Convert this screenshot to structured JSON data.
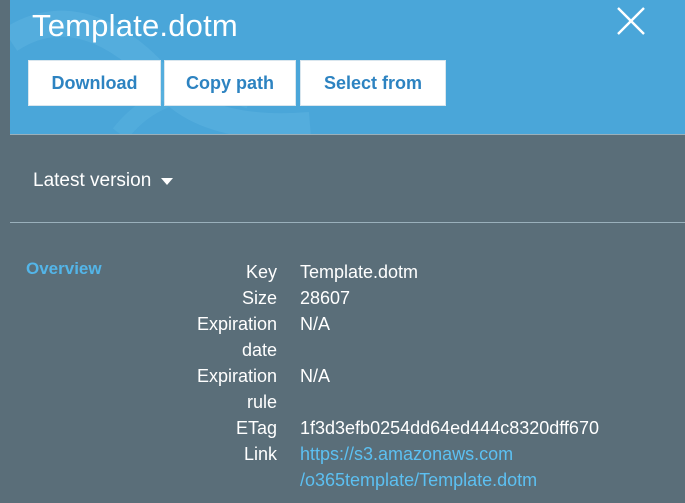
{
  "header": {
    "title": "Template.dotm",
    "buttons": {
      "download": "Download",
      "copy_path": "Copy path",
      "select_from": "Select from"
    },
    "close_icon": "close-icon"
  },
  "version": {
    "label": "Latest version",
    "icon": "caret-down-icon"
  },
  "overview": {
    "label": "Overview"
  },
  "properties": {
    "key": {
      "label": "Key",
      "value": "Template.dotm"
    },
    "size": {
      "label": "Size",
      "value": "28607"
    },
    "expiration_date": {
      "label_line1": "Expiration",
      "label_line2": "date",
      "value": "N/A"
    },
    "expiration_rule": {
      "label_line1": "Expiration",
      "label_line2": "rule",
      "value": "N/A"
    },
    "etag": {
      "label": "ETag",
      "value": "1f3d3efb0254dd64ed444c8320dff670"
    },
    "link": {
      "label": "Link",
      "line1": "https://s3.amazonaws.com",
      "line2": "/o365template/Template.dotm"
    }
  },
  "colors": {
    "header_bg": "#4aa6d9",
    "panel_bg": "#5a6e79",
    "button_text": "#2d83c1",
    "accent_text": "#53b5e8",
    "link_text": "#5cc0f2"
  }
}
